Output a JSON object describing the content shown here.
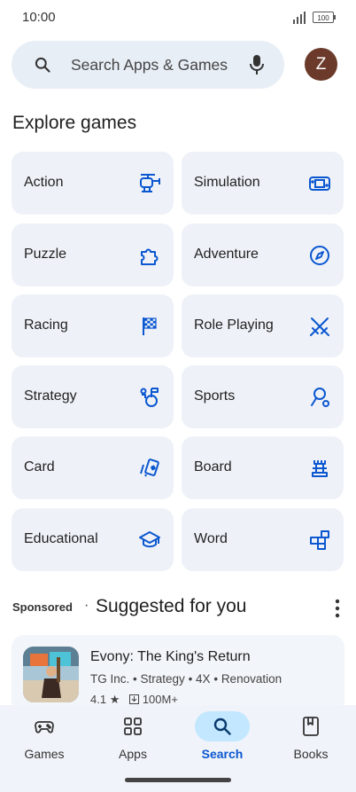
{
  "status": {
    "time": "10:00",
    "battery": "100"
  },
  "search": {
    "placeholder": "Search Apps & Games"
  },
  "avatar": {
    "initial": "Z",
    "color": "#6b3a2a"
  },
  "explore": {
    "heading": "Explore games",
    "categories": [
      {
        "label": "Action",
        "icon": "helicopter-icon"
      },
      {
        "label": "Simulation",
        "icon": "gamepad-console-icon"
      },
      {
        "label": "Puzzle",
        "icon": "puzzle-piece-icon"
      },
      {
        "label": "Adventure",
        "icon": "compass-icon"
      },
      {
        "label": "Racing",
        "icon": "checkered-flag-icon"
      },
      {
        "label": "Role Playing",
        "icon": "crossed-swords-icon"
      },
      {
        "label": "Strategy",
        "icon": "chess-piece-icon"
      },
      {
        "label": "Sports",
        "icon": "golf-icon"
      },
      {
        "label": "Card",
        "icon": "playing-cards-icon"
      },
      {
        "label": "Board",
        "icon": "chess-rook-icon"
      },
      {
        "label": "Educational",
        "icon": "graduation-cap-icon"
      },
      {
        "label": "Word",
        "icon": "letter-tiles-icon"
      }
    ]
  },
  "suggested": {
    "sponsored": "Sponsored",
    "separator": "·",
    "title": "Suggested for you",
    "app": {
      "name": "Evony: The King's Return",
      "developer": "TG Inc.",
      "tags": [
        "Strategy",
        "4X",
        "Renovation"
      ],
      "rating": "4.1",
      "downloads": "100M+"
    }
  },
  "nav": {
    "items": [
      {
        "label": "Games",
        "icon": "gamepad-icon",
        "active": false
      },
      {
        "label": "Apps",
        "icon": "apps-grid-icon",
        "active": false
      },
      {
        "label": "Search",
        "icon": "search-icon",
        "active": true
      },
      {
        "label": "Books",
        "icon": "book-icon",
        "active": false
      }
    ]
  },
  "colors": {
    "accent": "#0b57d0",
    "tile_bg": "#eef2f8",
    "search_bg": "#e8eef6",
    "active_pill": "#c2e7ff"
  }
}
